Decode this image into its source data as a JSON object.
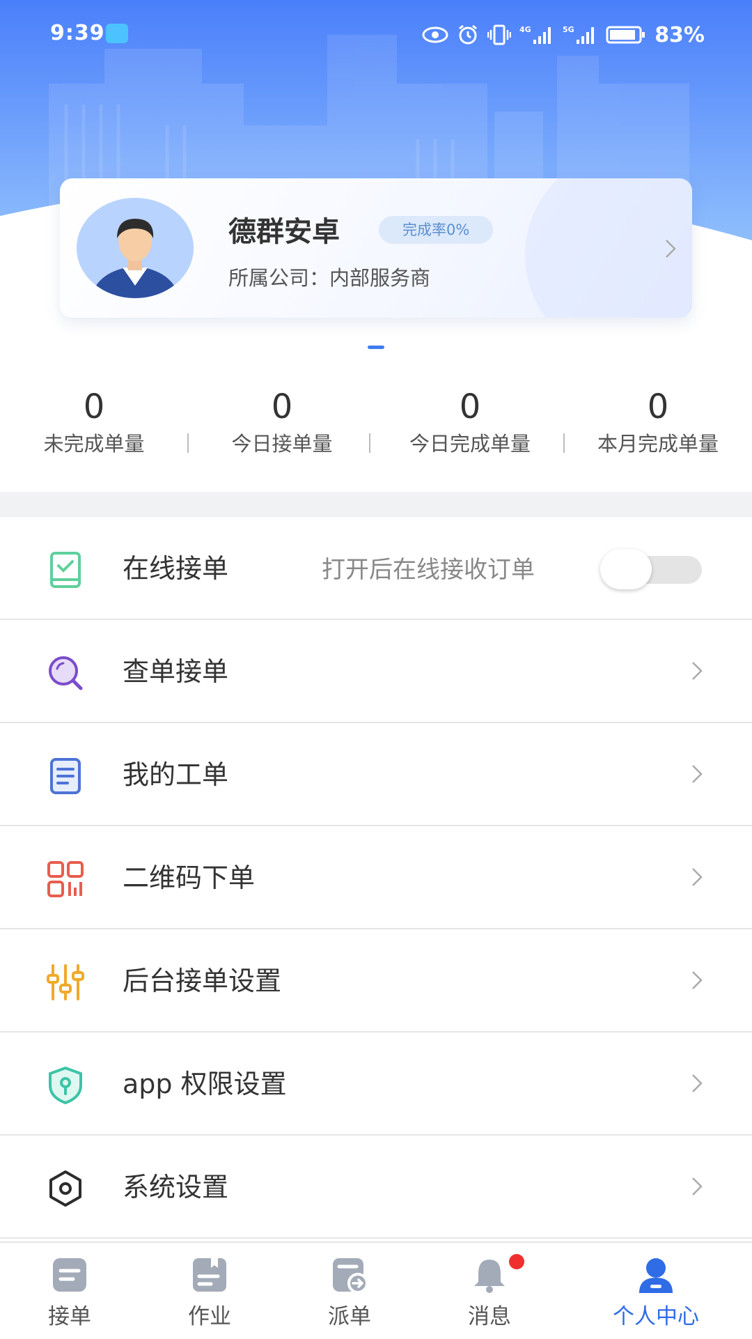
{
  "status_bar": {
    "time": "9:39",
    "icons": [
      "app-notification-icon",
      "eye-icon",
      "alarm-icon",
      "vibrate-icon",
      "signal-4g-icon",
      "signal-5g-icon",
      "battery-icon"
    ],
    "battery": "83%"
  },
  "profile": {
    "name": "德群安卓",
    "completion_badge": "完成率0%",
    "company_label": "所属公司：",
    "company_value": "内部服务商"
  },
  "stats": [
    {
      "value": "0",
      "label": "未完成单量"
    },
    {
      "value": "0",
      "label": "今日接单量"
    },
    {
      "value": "0",
      "label": "今日完成单量"
    },
    {
      "value": "0",
      "label": "本月完成单量"
    }
  ],
  "menu": {
    "online": {
      "label": "在线接单",
      "hint": "打开后在线接收订单",
      "toggle_on": false,
      "icon": "order-check-icon"
    },
    "items": [
      {
        "label": "查单接单",
        "icon": "search-icon"
      },
      {
        "label": "我的工单",
        "icon": "document-icon"
      },
      {
        "label": "二维码下单",
        "icon": "qr-code-icon"
      },
      {
        "label": "后台接单设置",
        "icon": "sliders-icon"
      },
      {
        "label": "app 权限设置",
        "icon": "shield-icon"
      },
      {
        "label": "系统设置",
        "icon": "settings-hexagon-icon"
      }
    ]
  },
  "tabbar": [
    {
      "label": "接单",
      "icon": "order-icon",
      "active": false
    },
    {
      "label": "作业",
      "icon": "task-icon",
      "active": false
    },
    {
      "label": "派单",
      "icon": "dispatch-icon",
      "active": false
    },
    {
      "label": "消息",
      "icon": "bell-icon",
      "active": false,
      "badge": true
    },
    {
      "label": "个人中心",
      "icon": "user-icon",
      "active": true
    }
  ],
  "colors": {
    "primary": "#2f6ce5",
    "header_top": "#4a80fb",
    "header_bottom": "#9dc6ff",
    "badge_red": "#f02f2f"
  }
}
